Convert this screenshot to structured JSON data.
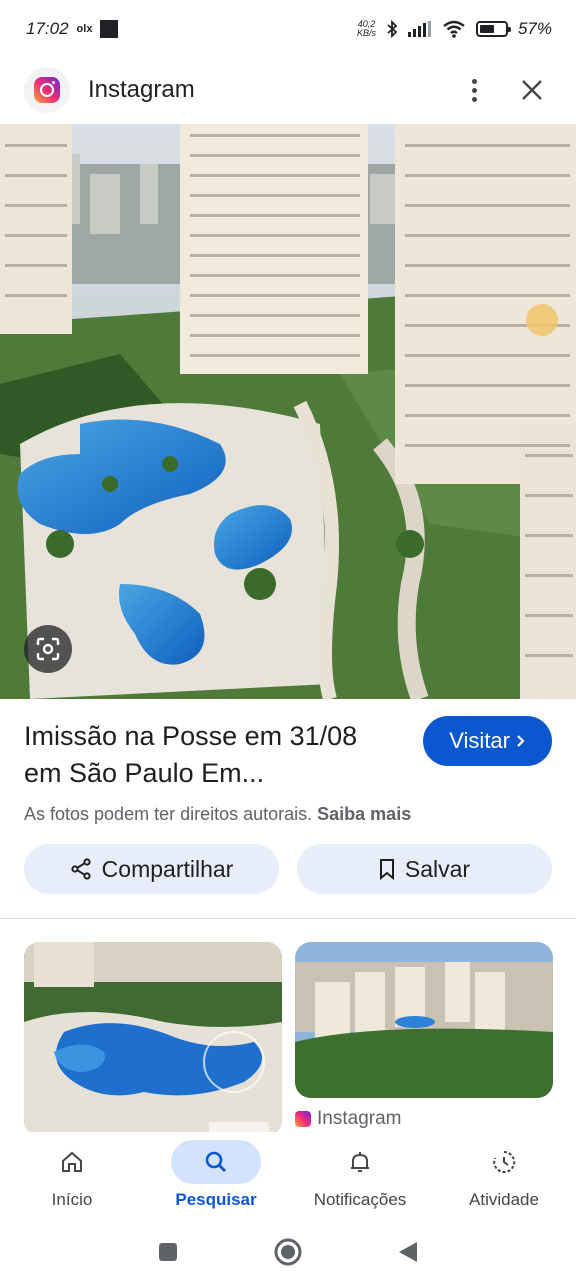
{
  "status_bar": {
    "time": "17:02",
    "carrier_badge": "olx",
    "net_speed_value": "40,2",
    "net_speed_unit": "KB/s",
    "battery_percent": "57%",
    "battery_level": 0.57
  },
  "header": {
    "title": "Instagram",
    "more_icon": "more-vert-icon",
    "close_icon": "close-icon"
  },
  "result": {
    "title": "Imissão na Posse em 31/08 em São Paulo Em...",
    "visit_label": "Visitar",
    "copyright_text": "As fotos podem ter direitos autorais.",
    "learn_more": "Saiba mais"
  },
  "actions": {
    "share_label": "Compartilhar",
    "save_label": "Salvar"
  },
  "related": {
    "second_source": "Instagram"
  },
  "bottom_nav": {
    "items": [
      {
        "label": "Início",
        "icon": "home-icon"
      },
      {
        "label": "Pesquisar",
        "icon": "search-icon"
      },
      {
        "label": "Notificações",
        "icon": "bell-icon"
      },
      {
        "label": "Atividade",
        "icon": "history-icon"
      }
    ],
    "active_index": 1
  },
  "colors": {
    "accent": "#0b57d0",
    "pill_bg": "#e8eef9",
    "active_nav_bg": "#d3e3fd"
  }
}
